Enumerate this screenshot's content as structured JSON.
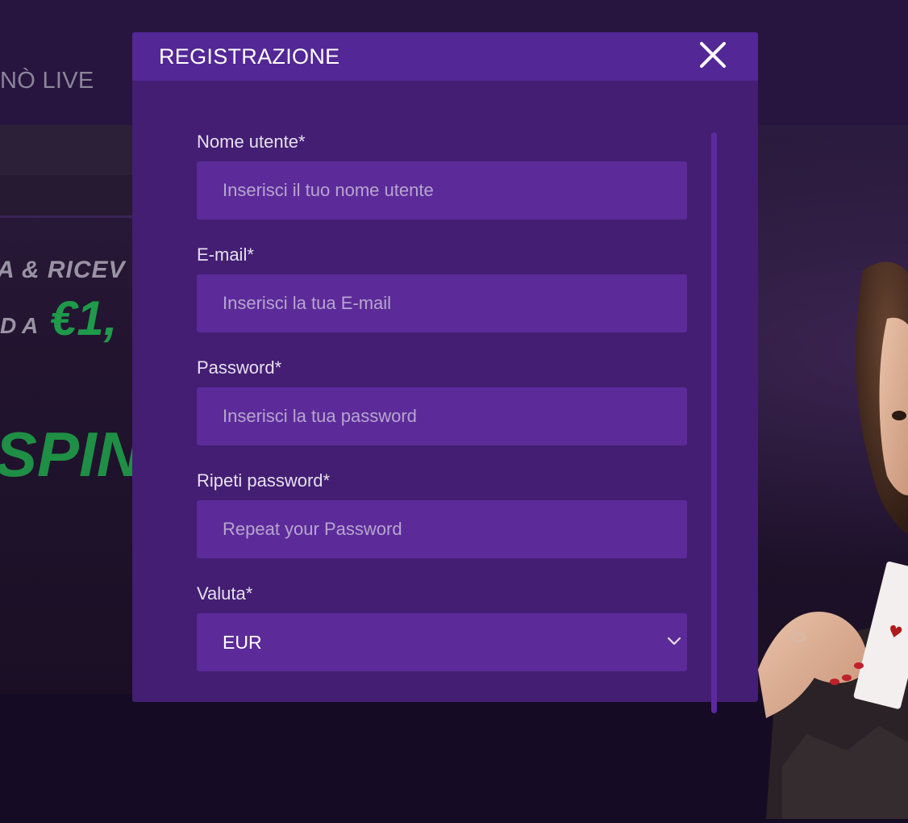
{
  "background": {
    "nav_text": "NÒ LIVE",
    "promo_line1": "A & RICEV",
    "promo_prefix": "D A",
    "promo_amount": "€1,",
    "promo_spin": "SPIN"
  },
  "modal": {
    "title": "REGISTRAZIONE",
    "fields": {
      "username": {
        "label": "Nome utente*",
        "placeholder": "Inserisci il tuo nome utente",
        "value": ""
      },
      "email": {
        "label": "E-mail*",
        "placeholder": "Inserisci la tua E-mail",
        "value": ""
      },
      "password": {
        "label": "Password*",
        "placeholder": "Inserisci la tua password",
        "value": ""
      },
      "repeat_password": {
        "label": "Ripeti password*",
        "placeholder": "Repeat your Password",
        "value": ""
      },
      "currency": {
        "label": "Valuta*",
        "selected": "EUR"
      }
    }
  },
  "colors": {
    "modal_bg": "#431e73",
    "header_bg": "#532796",
    "input_bg": "#5c2b99",
    "page_top": "#271540",
    "promo_green": "#1e9a4a"
  },
  "icons": {
    "close": "close-icon",
    "dropdown": "chevron-down-icon"
  }
}
